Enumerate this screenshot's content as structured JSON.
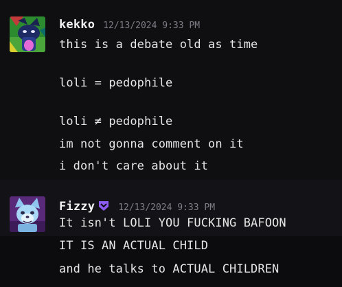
{
  "messages": [
    {
      "username": "kekko",
      "timestamp": "12/13/2024 9:33 PM",
      "avatar_icon": "fox-character-avatar-icon",
      "lines": [
        "this is a debate old as time",
        "loli = pedophile",
        "loli ≠ pedophile",
        "im not gonna comment on it",
        "i don't care about it"
      ]
    },
    {
      "username": "Fizzy",
      "badge_icon": "purple-shield-badge-icon",
      "badge_color": "#8c5cf5",
      "timestamp": "12/13/2024 9:33 PM",
      "avatar_icon": "wolf-character-avatar-icon",
      "lines": [
        "It isn't LOLI YOU FUCKING BAFOON",
        "IT IS AN ACTUAL CHILD",
        "and he talks to ACTUAL CHILDREN"
      ]
    }
  ]
}
